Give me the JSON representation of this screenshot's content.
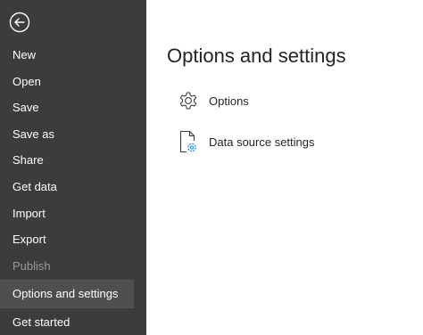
{
  "sidebar": {
    "back_icon": "back-arrow-icon",
    "items": [
      {
        "label": "New",
        "state": "normal"
      },
      {
        "label": "Open",
        "state": "normal"
      },
      {
        "label": "Save",
        "state": "normal"
      },
      {
        "label": "Save as",
        "state": "normal"
      },
      {
        "label": "Share",
        "state": "normal"
      },
      {
        "label": "Get data",
        "state": "normal"
      },
      {
        "label": "Import",
        "state": "normal"
      },
      {
        "label": "Export",
        "state": "normal"
      },
      {
        "label": "Publish",
        "state": "disabled"
      },
      {
        "label": "Options and settings",
        "state": "selected"
      },
      {
        "label": "Get started",
        "state": "normal"
      }
    ]
  },
  "main": {
    "title": "Options and settings",
    "options": [
      {
        "label": "Options",
        "icon": "gear-icon"
      },
      {
        "label": "Data source settings",
        "icon": "data-source-settings-icon"
      }
    ]
  },
  "colors": {
    "sidebar_bg": "#3c3c3c",
    "selected_bg": "#4f4f4f",
    "disabled_text": "#9a9a9a",
    "accent": "#118dff"
  }
}
